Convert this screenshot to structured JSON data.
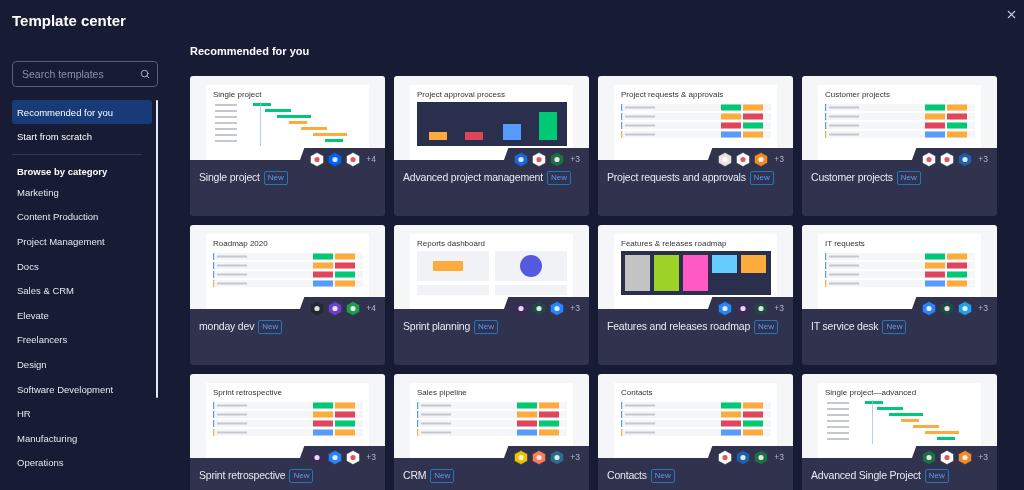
{
  "title": "Template center",
  "search": {
    "placeholder": "Search templates"
  },
  "nav": [
    {
      "label": "Recommended for you",
      "selected": true
    },
    {
      "label": "Start from scratch",
      "selected": false
    }
  ],
  "category_heading": "Browse by category",
  "categories": [
    "Marketing",
    "Content Production",
    "Project Management",
    "Docs",
    "Sales & CRM",
    "Elevate",
    "Freelancers",
    "Design",
    "Software Development",
    "HR",
    "Manufacturing",
    "Operations"
  ],
  "section_title": "Recommended for you",
  "cards": [
    {
      "title": "Single project",
      "badge": "New",
      "preview": {
        "title": "Single project",
        "kind": "gantt"
      },
      "icons": [
        {
          "color": "#ffffff"
        },
        {
          "color": "#0061fe"
        },
        {
          "color": "#ffffff"
        }
      ],
      "more": "+4"
    },
    {
      "title": "Advanced project management",
      "badge": "New",
      "preview": {
        "title": "Project approval process",
        "kind": "chart"
      },
      "icons": [
        {
          "color": "#1868db"
        },
        {
          "color": "#ffffff"
        },
        {
          "color": "#1d7044"
        }
      ],
      "more": "+3"
    },
    {
      "title": "Project requests and approvals",
      "badge": "New",
      "preview": {
        "title": "Project requests & approvals",
        "kind": "table"
      },
      "icons": [
        {
          "color": "#e8e4d8"
        },
        {
          "color": "#ffffff"
        },
        {
          "color": "#f08a24"
        }
      ],
      "more": "+3"
    },
    {
      "title": "Customer projects",
      "badge": "New",
      "preview": {
        "title": "Customer projects",
        "kind": "table"
      },
      "icons": [
        {
          "color": "#ffffff"
        },
        {
          "color": "#ffffff"
        },
        {
          "color": "#1e5fa8"
        }
      ],
      "more": "+3"
    },
    {
      "title": "monday dev",
      "badge": "New",
      "preview": {
        "title": "Roadmap 2020",
        "kind": "table"
      },
      "icons": [
        {
          "color": "#24292e"
        },
        {
          "color": "#6e41c7"
        },
        {
          "color": "#1e9e4a"
        }
      ],
      "more": "+4"
    },
    {
      "title": "Sprint planning",
      "badge": "New",
      "preview": {
        "title": "Reports dashboard",
        "kind": "dashboard"
      },
      "icons": [
        {
          "color": "#3d2a5a"
        },
        {
          "color": "#1f4a44"
        },
        {
          "color": "#2684ff"
        }
      ],
      "more": "+3"
    },
    {
      "title": "Features and releases roadmap",
      "badge": "New",
      "preview": {
        "title": "Features & releases roadmap",
        "kind": "kanban"
      },
      "icons": [
        {
          "color": "#2684ff"
        },
        {
          "color": "#3d2a5a"
        },
        {
          "color": "#1f4a44"
        }
      ],
      "more": "+3"
    },
    {
      "title": "IT service desk",
      "badge": "New",
      "preview": {
        "title": "IT requests",
        "kind": "table"
      },
      "icons": [
        {
          "color": "#2684ff"
        },
        {
          "color": "#1f4a44"
        },
        {
          "color": "#1fa0e8"
        }
      ],
      "more": "+3"
    },
    {
      "title": "Sprint retrospective",
      "badge": "New",
      "preview": {
        "title": "Sprint retrospective",
        "kind": "table"
      },
      "icons": [
        {
          "color": "#3d2a5a"
        },
        {
          "color": "#2684ff"
        },
        {
          "color": "#ffffff"
        }
      ],
      "more": "+3"
    },
    {
      "title": "CRM",
      "badge": "New",
      "preview": {
        "title": "Sales pipeline",
        "kind": "table"
      },
      "icons": [
        {
          "color": "#f2c200"
        },
        {
          "color": "#ff7a59"
        },
        {
          "color": "#2a6f8c"
        }
      ],
      "more": "+3"
    },
    {
      "title": "Contacts",
      "badge": "New",
      "preview": {
        "title": "Contacts",
        "kind": "table"
      },
      "icons": [
        {
          "color": "#ffffff"
        },
        {
          "color": "#1e5fa8"
        },
        {
          "color": "#1d7044"
        }
      ],
      "more": "+3"
    },
    {
      "title": "Advanced Single Project",
      "badge": "New",
      "preview": {
        "title": "Single project—advanced",
        "kind": "gantt"
      },
      "icons": [
        {
          "color": "#1d7044"
        },
        {
          "color": "#ffffff"
        },
        {
          "color": "#f08a24"
        }
      ],
      "more": "+3"
    }
  ]
}
